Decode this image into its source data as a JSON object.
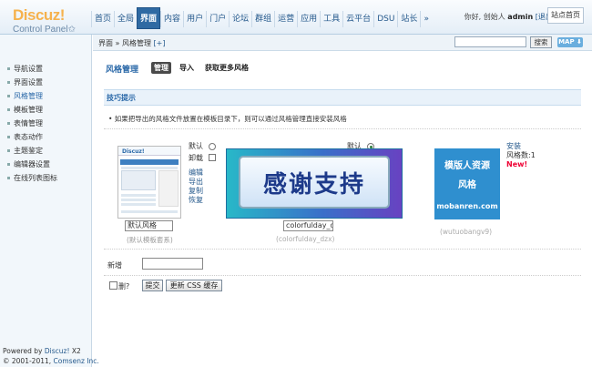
{
  "header": {
    "logo_main": "Discuz",
    "logo_mark": "!",
    "logo_sub": "Control Panel",
    "logo_sub_icon": "✩",
    "nav": [
      "首页",
      "全局",
      "界面",
      "内容",
      "用户",
      "门户",
      "论坛",
      "群组",
      "运营",
      "应用",
      "工具",
      "云平台",
      "DSU",
      "站长",
      "»"
    ],
    "active_nav": "界面",
    "greeting": "你好, 创始人",
    "username": "admin",
    "logout": "[退出]",
    "site_home": "站点首页"
  },
  "sidebar": {
    "items": [
      "导航设置",
      "界面设置",
      "风格管理",
      "模板管理",
      "表情管理",
      "表态动作",
      "主题鉴定",
      "编辑器设置",
      "在线列表图标"
    ],
    "active": "风格管理",
    "powered_prefix": "Powered by ",
    "powered_brand": "Discuz!",
    "powered_version": " X2",
    "copyright_prefix": "© 2001-2011, ",
    "copyright_company": "Comsenz Inc."
  },
  "breadcrumb": {
    "path": "界面 » 风格管理",
    "add": "[+]",
    "search_button": "搜索",
    "map_button": "MAP ⬇"
  },
  "page": {
    "title": "风格管理",
    "tabs": [
      "管理",
      "导入",
      "获取更多风格"
    ],
    "active_tab": "管理"
  },
  "tips": {
    "title": "技巧提示",
    "text": "• 如果把导出的风格文件放置在模板目录下，则可以通过风格管理直接安装风格"
  },
  "styles": [
    {
      "thumb_logo": "Discuz!",
      "name_value": "默认风格",
      "dir": "(默认模板套系)",
      "default_label": "默认",
      "uninstall_label": "卸载",
      "actions": [
        "编辑",
        "导出",
        "复制",
        "恢复"
      ],
      "is_default": false
    },
    {
      "banner_text": "感谢支持",
      "name_value": "colorfulday_d",
      "dir": "(colorfulday_dzx)",
      "default_label": "默认",
      "is_default": true
    },
    {
      "thumb_line1": "模版人资源",
      "thumb_line2": "风格",
      "thumb_line3": "mobanren.com",
      "install_label": "安装",
      "count_label": "风格数:1",
      "new_label": "New!",
      "dir": "(wutuobangv9)"
    }
  ],
  "form": {
    "new_label": "新增",
    "delete_label": "删?",
    "submit_button": "提交",
    "update_css_button": "更新 CSS 缓存"
  }
}
